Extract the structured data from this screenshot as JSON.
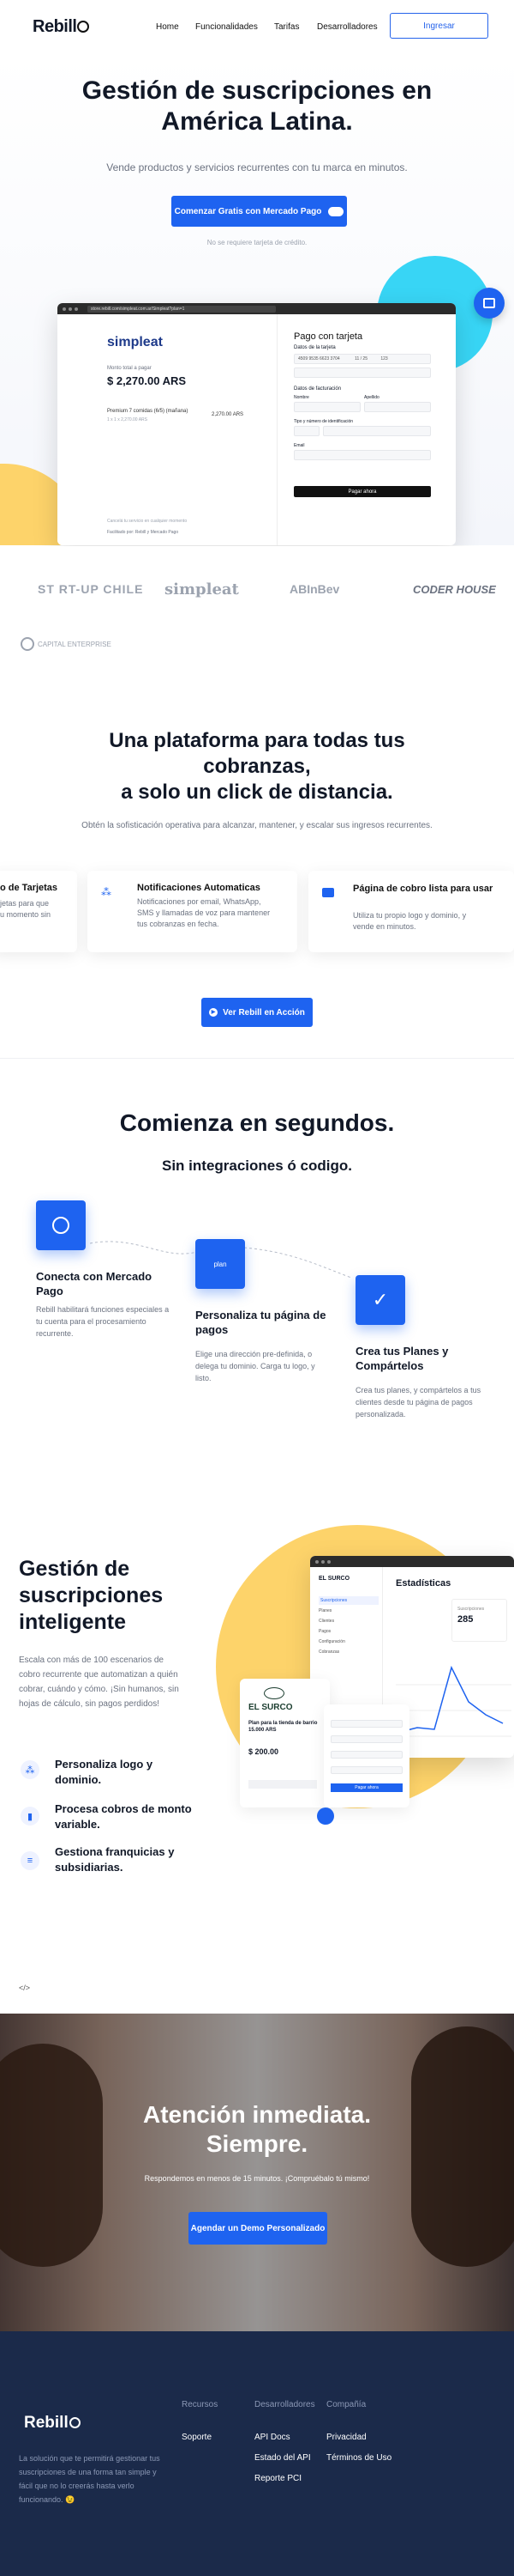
{
  "nav": {
    "logo": "Rebill",
    "links": [
      "Home",
      "Funcionalidades",
      "Tarifas",
      "Desarrolladores"
    ],
    "login": "Ingresar"
  },
  "hero": {
    "title_line1": "Gestión de suscripciones en",
    "title_line2": "América Latina.",
    "subtitle": "Vende productos y servicios recurrentes con tu marca en minutos.",
    "cta": "Comenzar Gratis con Mercado Pago",
    "note": "No se requiere tarjeta de crédito."
  },
  "mock_checkout": {
    "url": "store.rebill.com/simpleat.com.ar/Simpleat?plan=1",
    "brand": "simpleat",
    "label_total": "Monto total a pagar",
    "total": "$ 2,270.00 ARS",
    "plan_name": "Premium 7 comidas (6/5) (mañana)",
    "plan_sub": "1 x 1 x 2,270.00 ARS",
    "plan_price": "2,270.00 ARS",
    "footer_left": "Cancelá tu servicio en cualquier momento",
    "footer_powered": "Facilitado por: Rebill y Mercado Pago",
    "pay_title": "Pago con tarjeta",
    "card_section": "Datos de la tarjeta",
    "card_number": "4509 9535 6623 3704",
    "card_exp": "11 / 25",
    "card_cvv": "123",
    "billing_section": "Datos de facturación",
    "field_name": "Nombre",
    "field_lastname": "Apellido",
    "field_doc": "Tipo y número de identificación",
    "field_email": "Email",
    "pay_button": "Pagar ahora"
  },
  "partners": [
    "ST RT-UP CHILE",
    "simpleat",
    "ABInBev",
    "CODER HOUSE",
    "CAPITAL ENTERPRISE"
  ],
  "platform": {
    "title_line1": "Una plataforma para todas tus",
    "title_line2": "cobranzas,",
    "title_line3": "a solo un click de distancia.",
    "subtitle": "Obtén la sofisticación operativa para alcanzar, mantener, y escalar sus ingresos recurrentes.",
    "cards": [
      {
        "title": "o de Tarjetas",
        "desc": "jetas para que\nu momento sin"
      },
      {
        "title": "Notificaciones Automaticas",
        "desc": "Notificaciones por email, WhatsApp,\nSMS y llamadas de voz para mantener\ntus cobranzas en fecha."
      },
      {
        "title": "Página de cobro lista para usar",
        "desc": "Utiliza tu propio logo y dominio, y\nvende en minutos."
      }
    ],
    "cta": "Ver Rebill en Acción"
  },
  "start": {
    "title": "Comienza en segundos.",
    "subtitle": "Sin integraciones ó codigo.",
    "steps": [
      {
        "title": "Conecta con Mercado Pago",
        "desc": "Rebill habilitará funciones especiales a tu cuenta para el procesamiento recurrente."
      },
      {
        "title": "Personaliza tu página de pagos",
        "desc": "Elige una dirección pre-definida, o delega tu dominio. Carga tu logo, y listo."
      },
      {
        "title": "Crea tus Planes y Compártelos",
        "desc": "Crea tus planes, y compártelos a tus clientes desde tu página de pagos personalizada."
      }
    ],
    "step2_badge": "plan"
  },
  "management": {
    "title_line1": "Gestión de",
    "title_line2": "suscripciones",
    "title_line3": "inteligente",
    "desc": "Escala con más de 100 escenarios de cobro recurrente que automatizan a quién cobrar, cuándo y cómo. ¡Sin humanos, sin hojas de cálculo, sin pagos perdidos!",
    "bullets": [
      "Personaliza logo y dominio.",
      "Procesa cobros de monto variable.",
      "Gestiona franquicias y subsidiarias."
    ],
    "dash_title": "Estadísticas",
    "dash_brand": "EL SURCO",
    "dash_stat_label": "Suscripciones",
    "dash_stat_value": "285",
    "dash_menu": [
      "Suscripciones",
      "Planes",
      "Clientes",
      "Pagos",
      "Configuración",
      "Cobranzas"
    ],
    "pay_brand": "EL SURCO",
    "pay_plan": "Plan para la tienda de barrio 15.000 ARS",
    "pay_amount": "$ 200.00",
    "pay_button": "Pagar ahora"
  },
  "code_snippet": "</>",
  "support": {
    "title_line1": "Atención inmediata.",
    "title_line2": "Siempre.",
    "subtitle": "Respondemos en menos de 15 minutos. ¡Compruébalo tú mismo!",
    "cta": "Agendar un Demo Personalizado"
  },
  "footer": {
    "logo": "Rebill",
    "tagline": "La solución que te permitirá gestionar tus suscripciones de una forma tan simple y fácil que no lo creerás hasta verlo funcionando. 😉",
    "cols": [
      {
        "head": "Recursos",
        "links": [
          "Soporte"
        ]
      },
      {
        "head": "Desarrolladores",
        "links": [
          "API Docs",
          "Estado del API",
          "Reporte PCI"
        ]
      },
      {
        "head": "Compañía",
        "links": [
          "Privacidad",
          "Términos de Uso"
        ]
      }
    ]
  },
  "colors": {
    "primary": "#1e63f0",
    "cyan": "#38d5f5",
    "yellow": "#fdd36a",
    "footer": "#1b2a4a"
  }
}
